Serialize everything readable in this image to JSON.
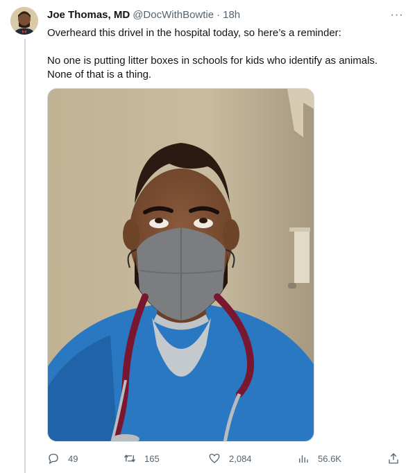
{
  "author": {
    "name": "Joe Thomas, MD",
    "handle": "@DocWithBowtie",
    "separator": "·",
    "time": "18h"
  },
  "more_label": "···",
  "tweet": {
    "line1": "Overheard this drivel in the hospital today, so here’s a reminder:",
    "line2": "No one is putting litter boxes in schools for kids who identify as animals.",
    "line3": "None of that is a thing."
  },
  "actions": {
    "replies": "49",
    "retweets": "165",
    "likes": "2,084",
    "views": "56.6K"
  },
  "icons": {
    "reply": "reply-icon",
    "retweet": "retweet-icon",
    "like": "heart-icon",
    "views": "views-icon",
    "share": "share-icon",
    "more": "more-icon"
  }
}
